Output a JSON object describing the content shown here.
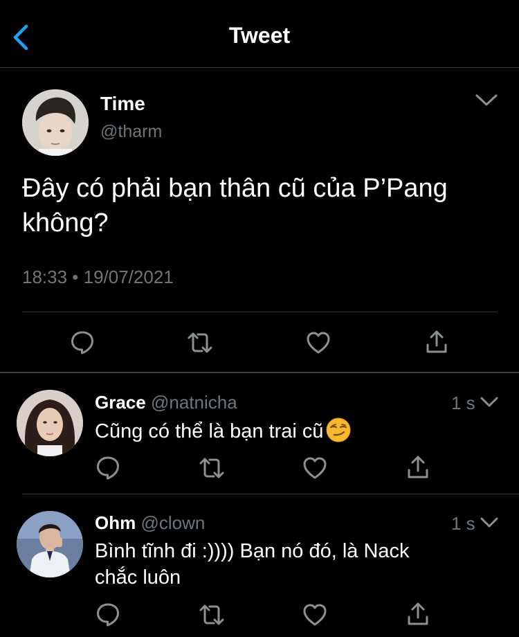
{
  "header": {
    "title": "Tweet"
  },
  "tweet": {
    "name": "Time",
    "handle": "@tharm",
    "text": "Đây có phải bạn thân cũ của P’Pang không?",
    "timestamp": "18:33 • 19/07/2021"
  },
  "replies": [
    {
      "name": "Grace",
      "handle": "@natnicha",
      "time": "1 s",
      "text": "Cũng có thể là bạn trai cũ",
      "emoji": "smirking-face"
    },
    {
      "name": "Ohm",
      "handle": "@clown",
      "time": "1 s",
      "text": "Bình tĩnh đi :)))) Bạn nó đó, là Nack chắc luôn"
    }
  ],
  "icons": {
    "back": "chevron-left-icon",
    "more": "chevron-down-icon",
    "reply": "speech-bubble-icon",
    "retweet": "retweet-icon",
    "like": "heart-icon",
    "share": "share-icon"
  },
  "colors": {
    "background": "#000000",
    "accent": "#1da1f2",
    "secondary_text": "#6e767d",
    "divider": "#2f3336"
  }
}
